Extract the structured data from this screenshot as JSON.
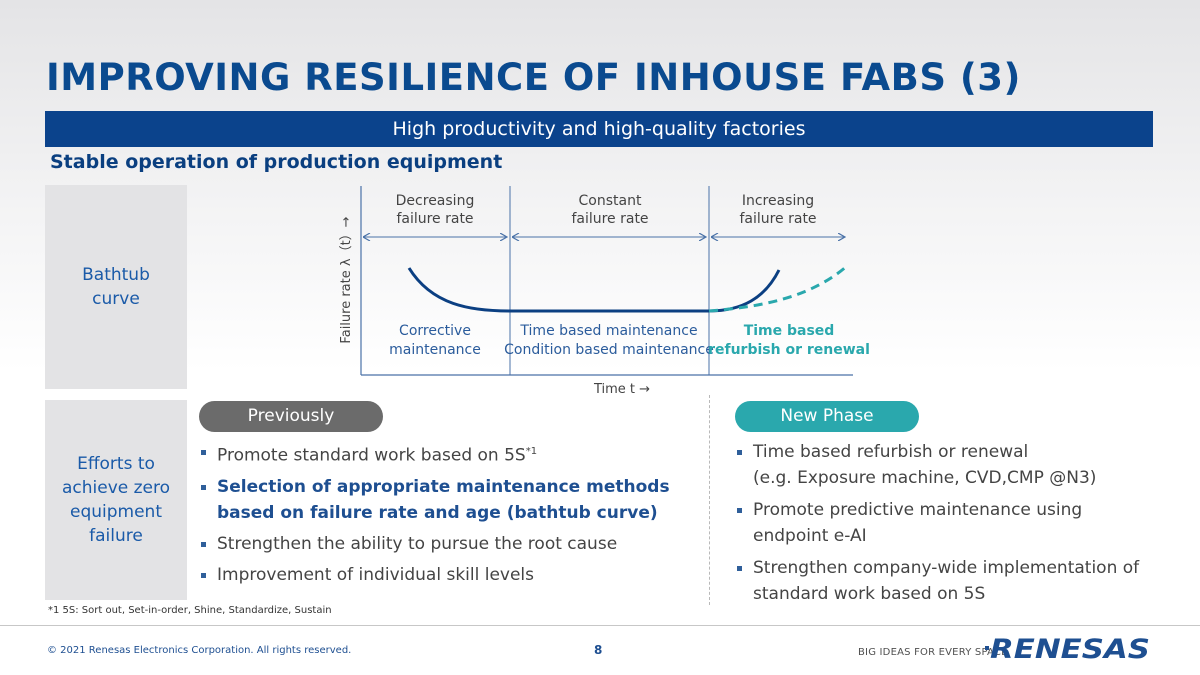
{
  "title": "IMPROVING RESILIENCE OF INHOUSE FABS (3)",
  "banner": "High productivity and high-quality factories",
  "section_title": "Stable operation of production equipment",
  "row_labels": {
    "bathtub": "Bathtub curve",
    "efforts": "Efforts to achieve zero equipment failure"
  },
  "chart": {
    "y_axis_label": "Failure rate λ（t）→",
    "x_axis_label": "Time t →",
    "phases": [
      {
        "header_line1": "Decreasing",
        "header_line2": "failure rate",
        "method_line1": "Corrective",
        "method_line2": "maintenance"
      },
      {
        "header_line1": "Constant",
        "header_line2": "failure rate",
        "method_line1": "Time based maintenance",
        "method_line2": "Condition based maintenance"
      },
      {
        "header_line1": "Increasing",
        "header_line2": "failure rate",
        "method_line1": "Time based",
        "method_line2": "refurbish or renewal"
      }
    ],
    "colors": {
      "solid_curve": "#0b3f82",
      "dashed_curve": "#2aa8ad",
      "axis": "#4a72a8"
    }
  },
  "previously": {
    "label": "Previously",
    "items": [
      {
        "text": "Promote standard work based on 5S",
        "sup": "*1"
      },
      {
        "text": "Selection of appropriate maintenance methods based on failure rate and age (bathtub curve)",
        "highlight": true
      },
      {
        "text": "Strengthen the ability to pursue the root cause"
      },
      {
        "text": "Improvement of individual skill levels"
      }
    ]
  },
  "new_phase": {
    "label": "New Phase",
    "items": [
      {
        "line1": "Time based refurbish or renewal",
        "line2": "(e.g. Exposure machine, CVD,CMP @N3)"
      },
      {
        "line1": "Promote predictive maintenance using",
        "line2": "endpoint e-AI"
      },
      {
        "line1": "Strengthen company-wide implementation of",
        "line2": "standard work based on 5S"
      }
    ]
  },
  "footnote": "*1 5S: Sort out, Set-in-order, Shine, Standardize, Sustain",
  "footer": {
    "copyright": "© 2021 Renesas Electronics Corporation. All rights reserved.",
    "page_number": "8",
    "tagline": "BIG IDEAS FOR EVERY SPACE",
    "logo_text": "RENESAS"
  }
}
